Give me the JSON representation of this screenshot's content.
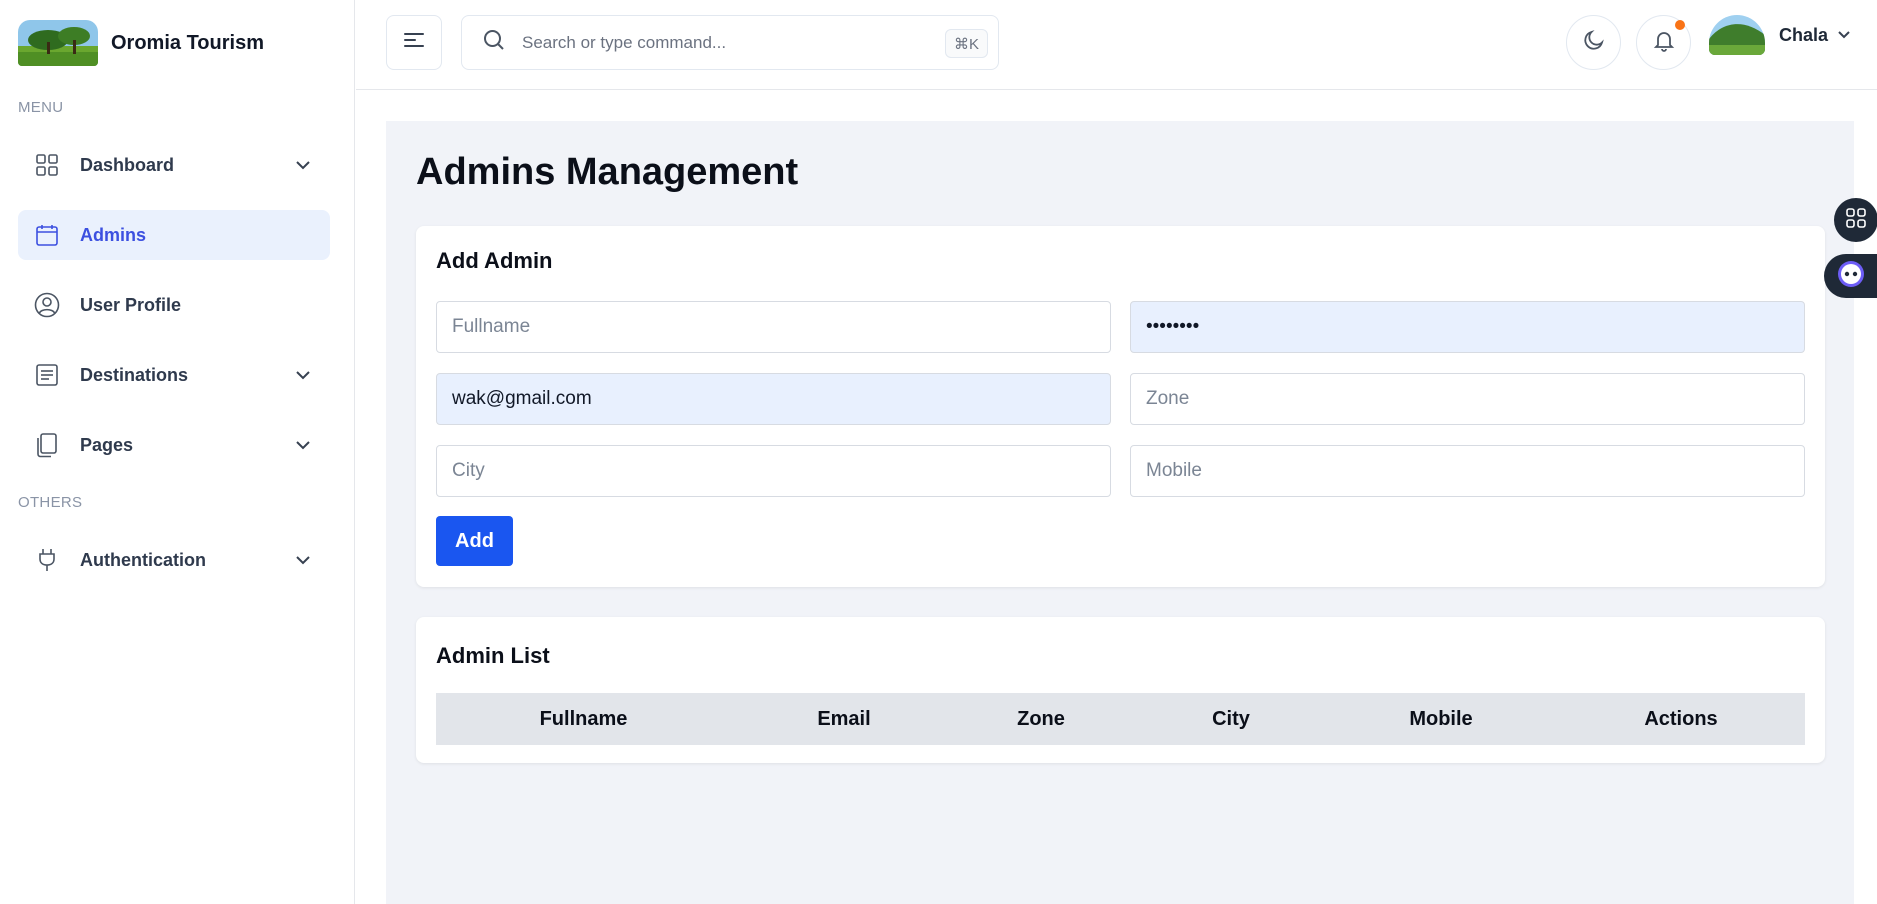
{
  "brand": {
    "name": "Oromia Tourism",
    "logo_icon": "landscape-logo"
  },
  "sidebar": {
    "menu_label": "MENU",
    "others_label": "OTHERS",
    "items": [
      {
        "label": "Dashboard",
        "icon": "grid-icon",
        "has_chevron": true
      },
      {
        "label": "Admins",
        "icon": "calendar-icon",
        "active": true
      },
      {
        "label": "User Profile",
        "icon": "user-circle-icon"
      },
      {
        "label": "Destinations",
        "icon": "document-list-icon",
        "has_chevron": true
      },
      {
        "label": "Pages",
        "icon": "pages-icon",
        "has_chevron": true
      },
      {
        "label": "Authentication",
        "icon": "plug-icon",
        "has_chevron": true
      }
    ]
  },
  "header": {
    "search_placeholder": "Search or type command...",
    "shortcut": "⌘K",
    "user_name": "Chala"
  },
  "main": {
    "page_title": "Admins Management",
    "add_admin": {
      "title": "Add Admin",
      "fullname_placeholder": "Fullname",
      "password_value": "••••••••",
      "email_value": "wak@gmail.com",
      "zone_placeholder": "Zone",
      "city_placeholder": "City",
      "mobile_placeholder": "Mobile",
      "add_label": "Add"
    },
    "admin_list": {
      "title": "Admin List",
      "columns": [
        "Fullname",
        "Email",
        "Zone",
        "City",
        "Mobile",
        "Actions"
      ]
    }
  },
  "colors": {
    "accent": "#3c50e0",
    "active_bg": "#eaf1fd",
    "primary_button": "#1a56f0",
    "notification_dot": "#f97316",
    "content_bg": "#f1f3f8",
    "autofill_bg": "#e8f0fe"
  }
}
